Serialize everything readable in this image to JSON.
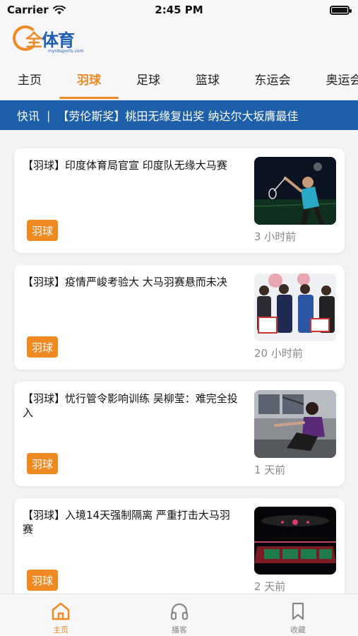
{
  "status_bar": {
    "carrier": "Carrier",
    "time": "2:45 PM"
  },
  "logo": {
    "text_first": "全",
    "text_rest": "体育",
    "sub": "mynbsports.com"
  },
  "tabs": [
    {
      "label": "主页"
    },
    {
      "label": "羽球"
    },
    {
      "label": "足球"
    },
    {
      "label": "篮球"
    },
    {
      "label": "东运会"
    },
    {
      "label": "奥运会"
    }
  ],
  "ticker": {
    "label": "快讯",
    "separator": "|",
    "text": "【劳伦斯奖】桃田无缘复出奖 纳达尔大坂膺最佳"
  },
  "articles": [
    {
      "title": "【羽球】印度体育局官宣 印度队无缘大马赛",
      "tag": "羽球",
      "time": "3 小时前",
      "thumb": "player"
    },
    {
      "title": "【羽球】疫情严峻考验大 大马羽赛悬而未决",
      "tag": "羽球",
      "time": "20 小时前",
      "thumb": "officials"
    },
    {
      "title": "【羽球】忧行管令影响训练 吴柳莹：难完全投入",
      "tag": "羽球",
      "time": "1 天前",
      "thumb": "training"
    },
    {
      "title": "【羽球】入境14天强制隔离 严重打击大马羽赛",
      "tag": "羽球",
      "time": "2 天前",
      "thumb": "arena"
    }
  ],
  "bottom_nav": [
    {
      "label": "主页",
      "icon": "home-icon"
    },
    {
      "label": "播客",
      "icon": "headphones-icon"
    },
    {
      "label": "收藏",
      "icon": "bookmark-icon"
    }
  ],
  "colors": {
    "accent": "#ef8a22",
    "brand_blue": "#1d5fa8"
  }
}
